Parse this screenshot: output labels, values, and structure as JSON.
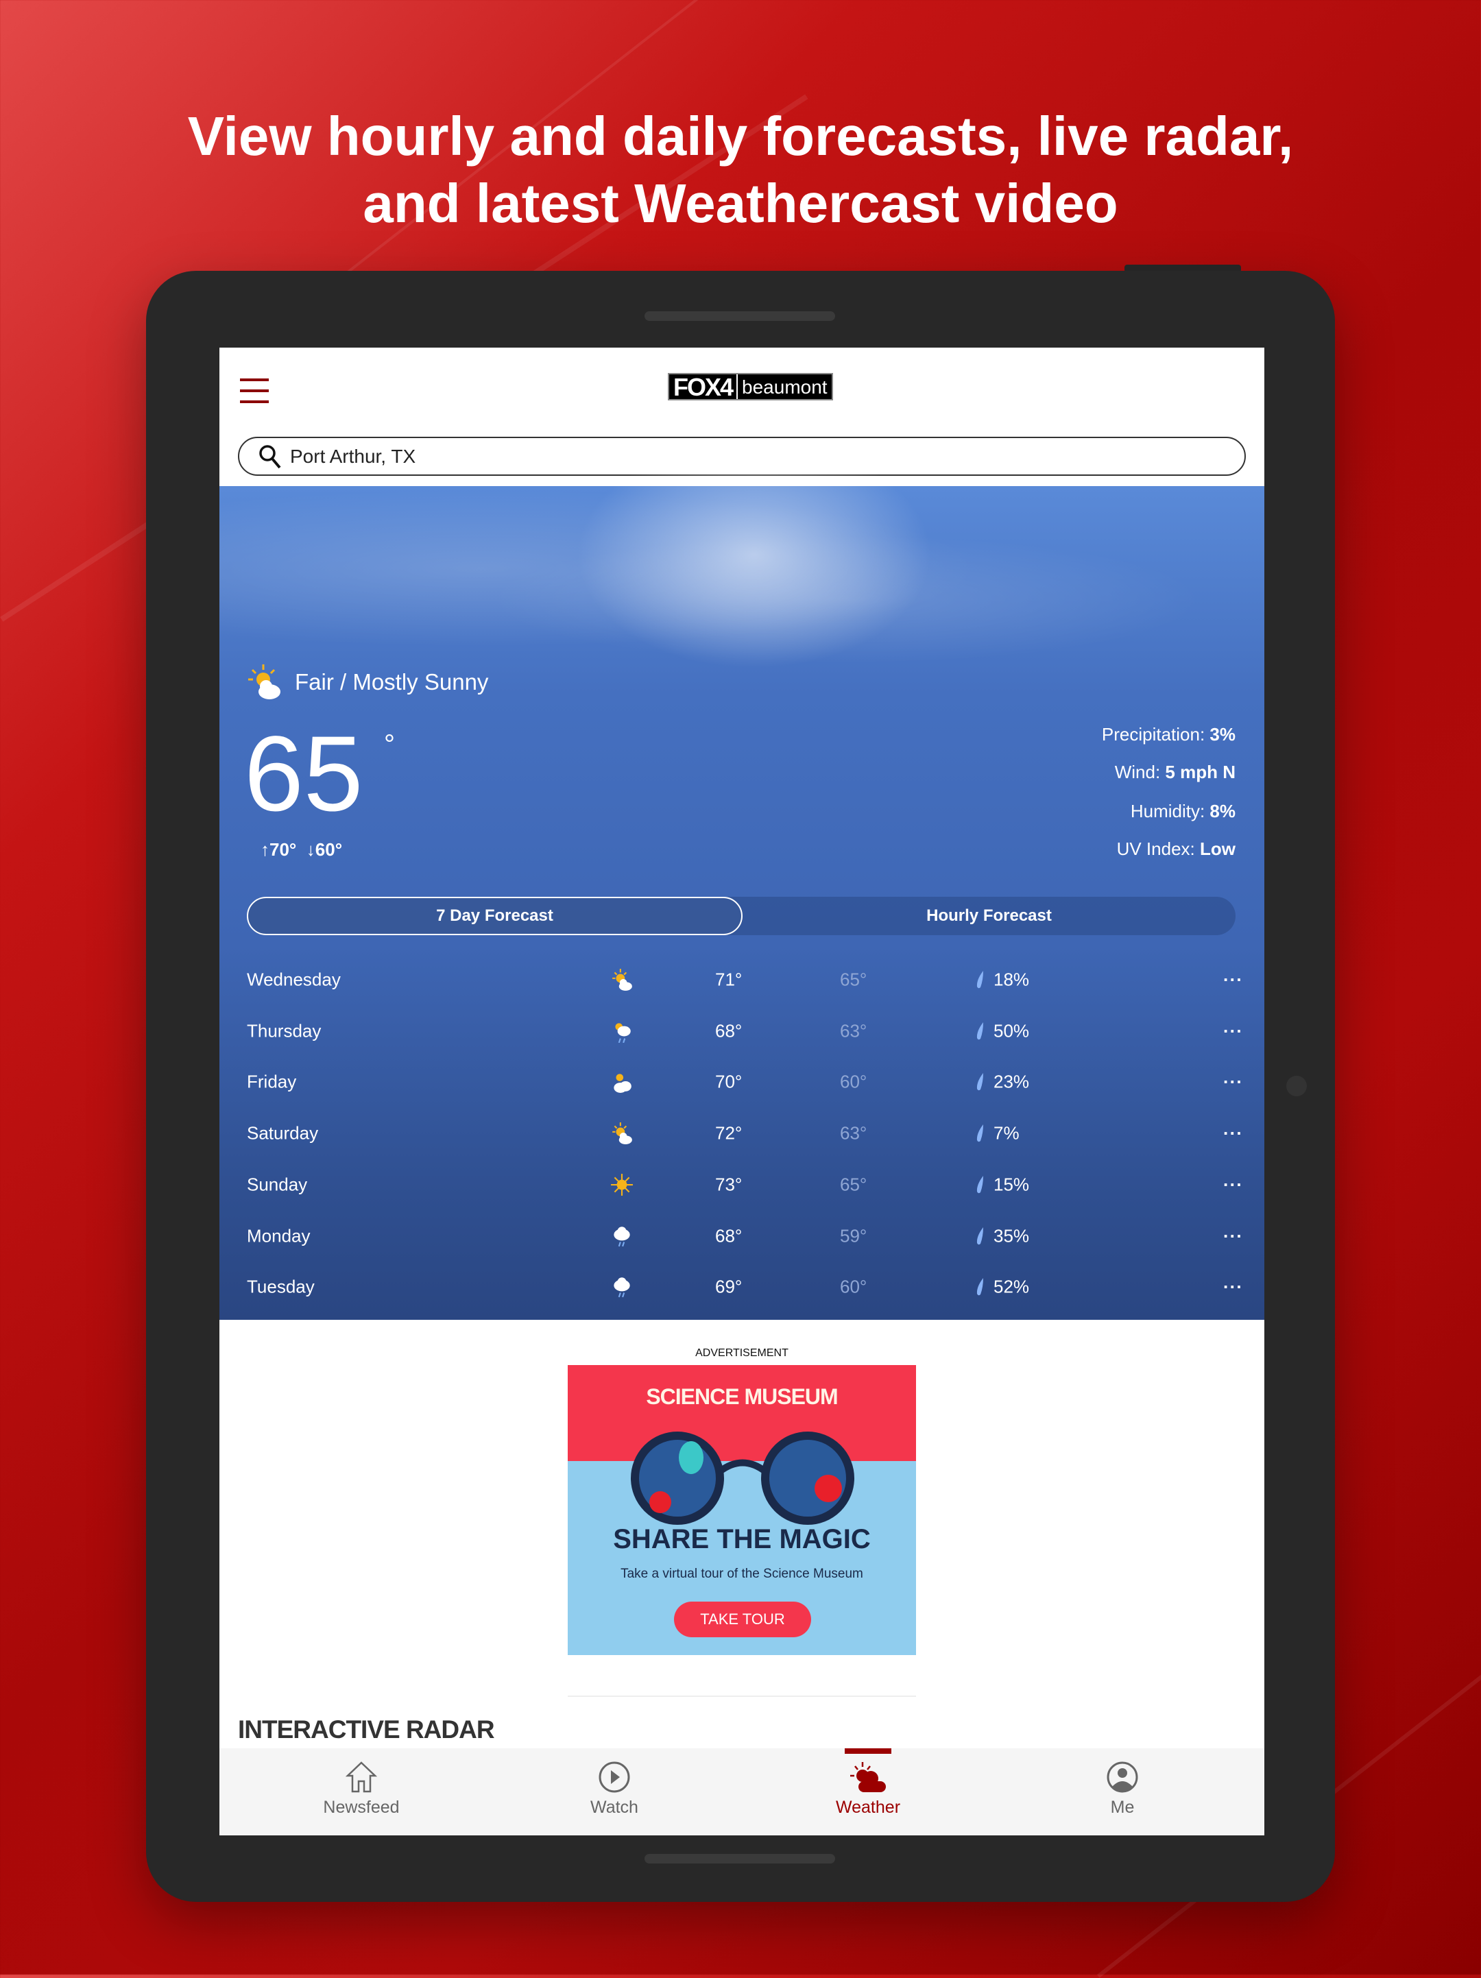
{
  "headline": {
    "line1": "View hourly and daily forecasts, live radar,",
    "line2": "and latest Weathercast video"
  },
  "app": {
    "logo_main": "FOX4",
    "logo_sub": "beaumont",
    "menu_icon": "hamburger-icon"
  },
  "search": {
    "value": "Port Arthur, TX",
    "icon": "search-icon"
  },
  "current": {
    "condition": "Fair / Mostly Sunny",
    "icon": "partly-sunny-icon",
    "temp": "65",
    "degree": "°",
    "high": "↑70°",
    "low": "↓60°",
    "details": [
      {
        "label": "Precipitation: ",
        "value": "3%"
      },
      {
        "label": "Wind: ",
        "value": "5 mph N"
      },
      {
        "label": "Humidity: ",
        "value": "8%"
      },
      {
        "label": "UV Index: ",
        "value": "Low"
      }
    ]
  },
  "tabs": [
    {
      "label": "7 Day Forecast",
      "active": true
    },
    {
      "label": "Hourly Forecast",
      "active": false
    }
  ],
  "forecast": [
    {
      "day": "Wednesday",
      "icon": "partly-sunny",
      "high": "71°",
      "low": "65°",
      "precip": "18%"
    },
    {
      "day": "Thursday",
      "icon": "sun-rain",
      "high": "68°",
      "low": "63°",
      "precip": "50%"
    },
    {
      "day": "Friday",
      "icon": "mostly-cloudy",
      "high": "70°",
      "low": "60°",
      "precip": "23%"
    },
    {
      "day": "Saturday",
      "icon": "partly-sunny",
      "high": "72°",
      "low": "63°",
      "precip": "7%"
    },
    {
      "day": "Sunday",
      "icon": "sunny",
      "high": "73°",
      "low": "65°",
      "precip": "15%"
    },
    {
      "day": "Monday",
      "icon": "rain",
      "high": "68°",
      "low": "59°",
      "precip": "35%"
    },
    {
      "day": "Tuesday",
      "icon": "rain",
      "high": "69°",
      "low": "60°",
      "precip": "52%"
    }
  ],
  "more_label": "···",
  "ad": {
    "label": "ADVERTISEMENT",
    "brand": "SCIENCE MUSEUM",
    "headline": "SHARE THE MAGIC",
    "sub": "Take a virtual tour of the Science Museum",
    "cta": "TAKE TOUR",
    "colors": {
      "red": "#f4364c",
      "blue": "#90cdee"
    }
  },
  "section": {
    "title": "INTERACTIVE RADAR"
  },
  "nav": [
    {
      "label": "Newsfeed",
      "icon": "home-icon"
    },
    {
      "label": "Watch",
      "icon": "play-icon"
    },
    {
      "label": "Weather",
      "icon": "weather-icon",
      "active": true
    },
    {
      "label": "Me",
      "icon": "user-icon"
    }
  ],
  "colors": {
    "accent": "#9b0000",
    "background": "#b00a0a",
    "hero": "#4570c0"
  }
}
